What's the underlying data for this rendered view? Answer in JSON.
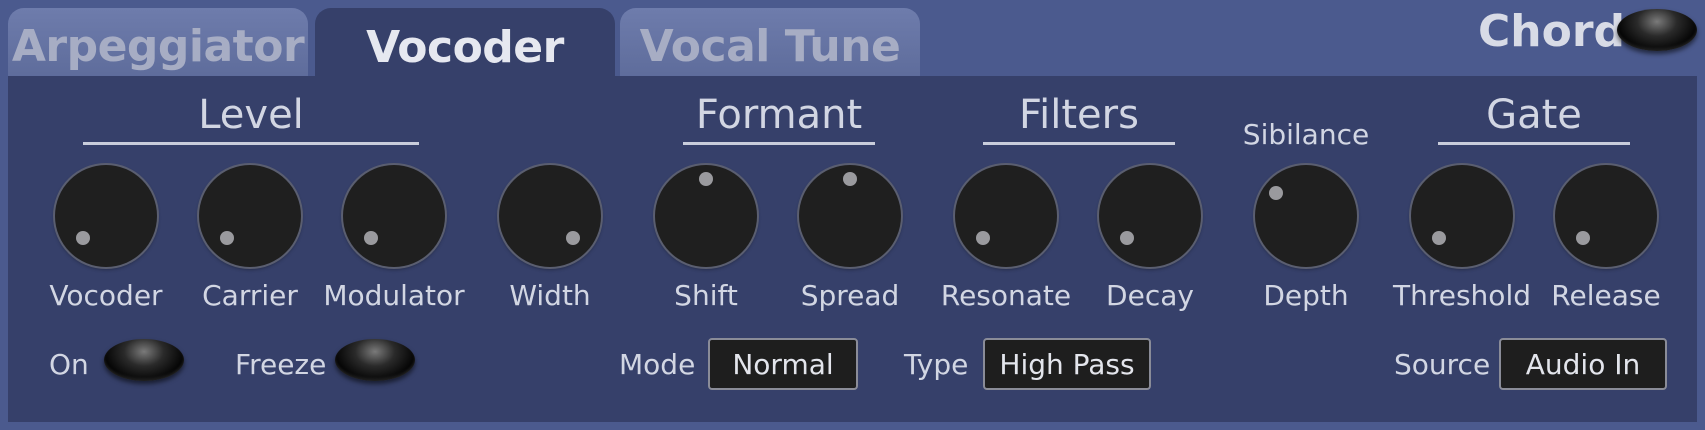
{
  "tabs": [
    {
      "label": "Arpeggiator",
      "active": false
    },
    {
      "label": "Vocoder",
      "active": true
    },
    {
      "label": "Vocal Tune",
      "active": false
    }
  ],
  "chord": {
    "label": "Chord",
    "on": false
  },
  "sections": {
    "level": "Level",
    "formant": "Formant",
    "filters": "Filters",
    "sibilance": "Sibilance",
    "gate": "Gate"
  },
  "knobs": [
    {
      "label": "Vocoder",
      "value": 0.0
    },
    {
      "label": "Carrier",
      "value": 0.0
    },
    {
      "label": "Modulator",
      "value": 0.0
    },
    {
      "label": "Width",
      "value": 1.0
    },
    {
      "label": "Shift",
      "value": 0.5
    },
    {
      "label": "Spread",
      "value": 0.5
    },
    {
      "label": "Resonate",
      "value": 0.0
    },
    {
      "label": "Decay",
      "value": 0.0
    },
    {
      "label": "Depth",
      "value": 0.2
    },
    {
      "label": "Threshold",
      "value": 0.0
    },
    {
      "label": "Release",
      "value": 0.0
    }
  ],
  "controls": {
    "on_label": "On",
    "freeze_label": "Freeze",
    "mode_label": "Mode",
    "mode_value": "Normal",
    "type_label": "Type",
    "type_value": "High Pass",
    "source_label": "Source",
    "source_value": "Audio In"
  },
  "colors": {
    "background": "#4b5a8e",
    "panel": "#36406a",
    "knob": "#1f1f1f",
    "text": "#d2d6e3"
  }
}
